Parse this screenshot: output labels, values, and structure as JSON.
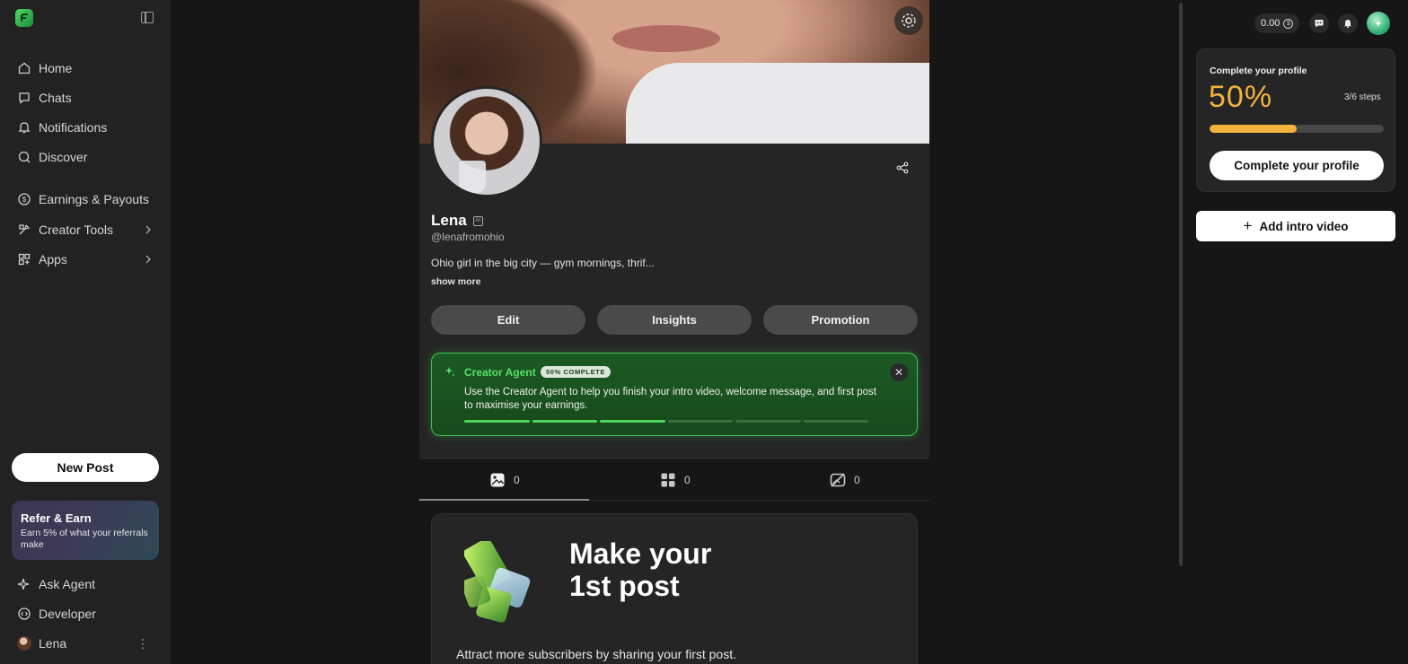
{
  "sidebar": {
    "nav": [
      {
        "label": "Home",
        "icon": "home-icon"
      },
      {
        "label": "Chats",
        "icon": "chat-icon"
      },
      {
        "label": "Notifications",
        "icon": "bell-icon"
      },
      {
        "label": "Discover",
        "icon": "search-icon"
      }
    ],
    "nav2": [
      {
        "label": "Earnings & Payouts",
        "icon": "dollar-icon"
      },
      {
        "label": "Creator Tools",
        "icon": "tools-icon"
      },
      {
        "label": "Apps",
        "icon": "apps-icon"
      }
    ],
    "new_post": "New Post",
    "refer": {
      "title": "Refer & Earn",
      "subtitle": "Earn 5% of what your referrals make"
    },
    "bottom": [
      {
        "label": "Ask Agent",
        "icon": "sparkle-icon"
      },
      {
        "label": "Developer",
        "icon": "code-icon"
      }
    ],
    "user": {
      "name": "Lena"
    }
  },
  "profile": {
    "name": "Lena",
    "ai_badge": "AI",
    "handle": "@lenafromohio",
    "bio": "Ohio girl in the big city — gym mornings, thrif...",
    "show_more": "show more",
    "actions": [
      "Edit",
      "Insights",
      "Promotion"
    ]
  },
  "creator_agent": {
    "title": "Creator Agent",
    "badge": "50% COMPLETE",
    "description": "Use the Creator Agent to help you finish your intro video, welcome message, and first post to maximise your earnings.",
    "steps_done": 3,
    "steps_total": 6,
    "close": "✕"
  },
  "tabs": [
    {
      "icon": "image-icon",
      "count": "0"
    },
    {
      "icon": "grid-icon",
      "count": "0"
    },
    {
      "icon": "hidden-image-icon",
      "count": "0"
    }
  ],
  "first_post": {
    "title_line1": "Make your",
    "title_line2": "1st post",
    "subtitle": "Attract more subscribers by sharing your first post."
  },
  "header": {
    "balance": "0.00",
    "balance_icon": "$"
  },
  "complete_profile": {
    "title": "Complete your profile",
    "percent": "50%",
    "progress": 0.5,
    "steps": "3/6 steps",
    "button": "Complete your profile"
  },
  "intro_video": {
    "button": "Add intro video"
  },
  "colors": {
    "accent_green": "#4fd45f",
    "progress_yellow": "#f2b23e"
  }
}
